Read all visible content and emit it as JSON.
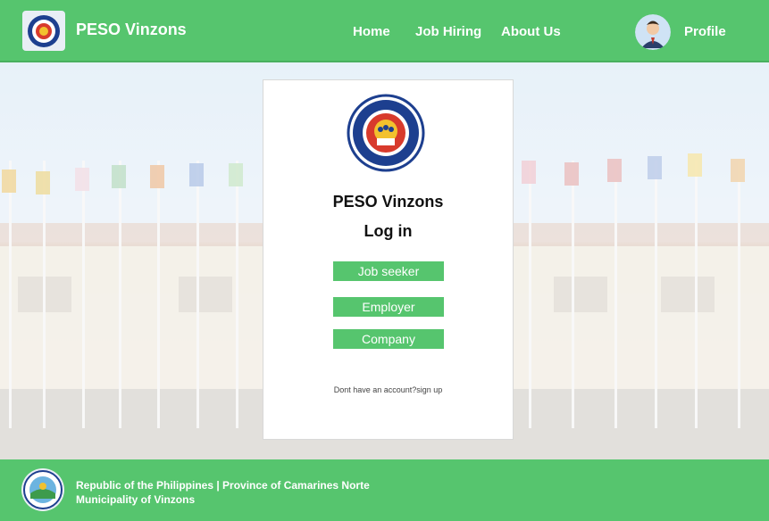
{
  "header": {
    "brand": "PESO Vinzons",
    "nav": [
      "Home",
      "Job Hiring",
      "About Us"
    ],
    "profile_label": "Profile"
  },
  "login": {
    "title": "PESO Vinzons",
    "subtitle": "Log in",
    "buttons": [
      "Job seeker",
      "Employer",
      "Company"
    ],
    "signup_text": "Dont have an account?sign up"
  },
  "footer": {
    "line1": "Republic of the Philippines | Province of Camarines Norte",
    "line2": "Municipality of Vinzons"
  },
  "colors": {
    "primary_green": "#56c56e",
    "card_bg": "#ffffff"
  },
  "icons": {
    "header_logo": "municipality-seal-icon",
    "card_logo": "peso-seal-icon",
    "avatar": "user-avatar-icon",
    "footer_logo": "municipality-seal-icon"
  }
}
